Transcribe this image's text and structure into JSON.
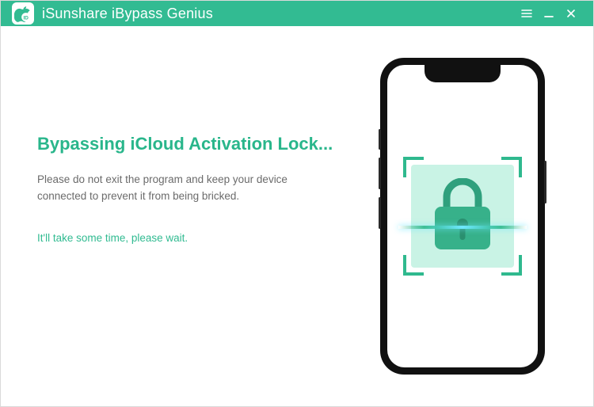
{
  "app": {
    "title": "iSunshare iBypass Genius"
  },
  "main": {
    "headline": "Bypassing iCloud Activation Lock...",
    "instruction": "Please do not exit the program and keep your device connected to prevent it from being bricked.",
    "wait_message": "It'll take some time, please wait."
  },
  "colors": {
    "accent": "#32bb92"
  }
}
